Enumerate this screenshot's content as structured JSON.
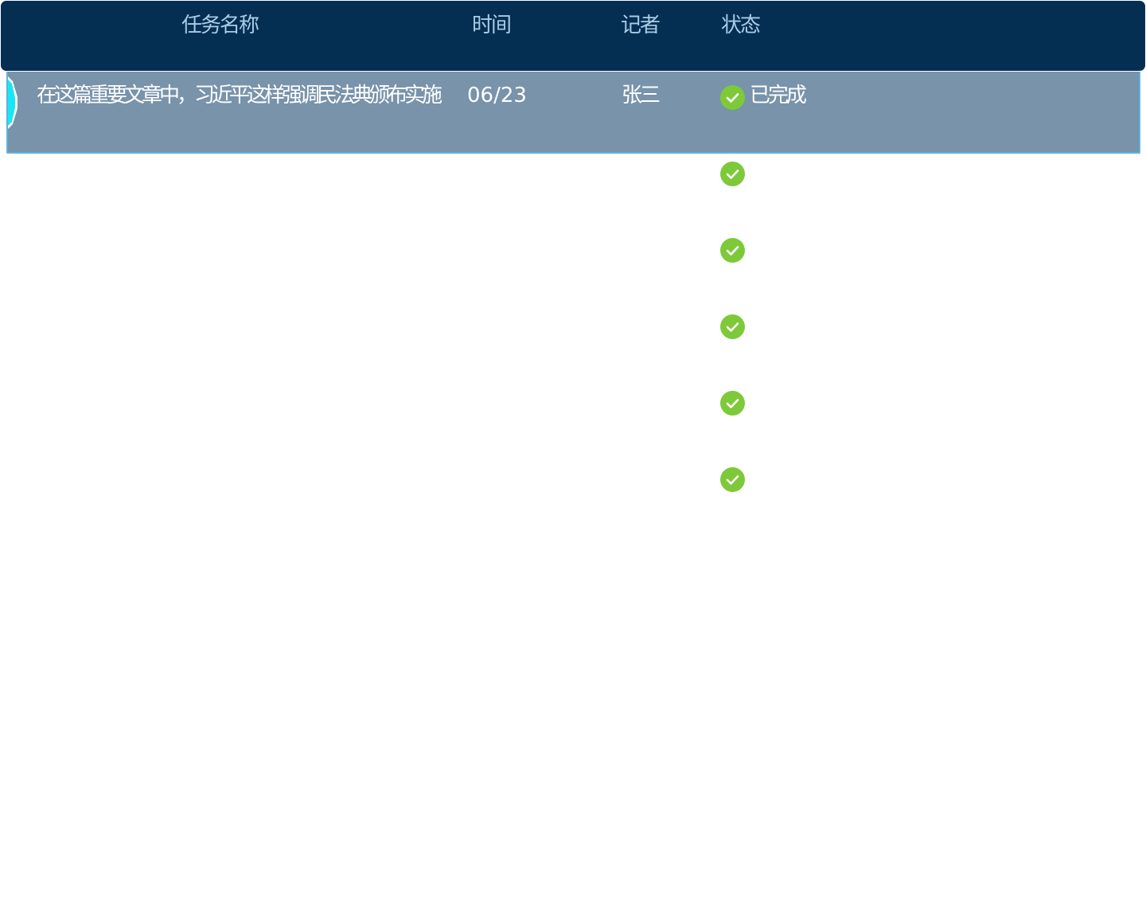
{
  "table": {
    "columns": {
      "task_name": "任务名称",
      "time": "时间",
      "reporter": "记者",
      "status": "状态"
    },
    "rows": [
      {
        "task_name": "在这篇重要文章中，习近平这样强调民法典颁布实施",
        "time": "06/23",
        "reporter": "张三",
        "status": "已完成",
        "status_icon": "check-circle-icon"
      },
      {
        "status_icon": "check-circle-icon"
      },
      {
        "status_icon": "check-circle-icon"
      },
      {
        "status_icon": "check-circle-icon"
      },
      {
        "status_icon": "check-circle-icon"
      },
      {
        "status_icon": "check-circle-icon"
      }
    ]
  },
  "colors": {
    "header_bg": "#042e52",
    "header_text": "#a9cce6",
    "active_row_bg": "#7893aa",
    "active_row_border": "#5bb4df",
    "row_marker": "#19e6f4",
    "status_done": "#7ec93a"
  }
}
